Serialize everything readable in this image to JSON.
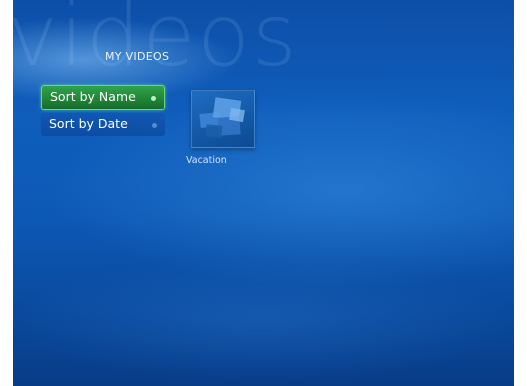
{
  "background_watermark": "videos",
  "section_title": "MY VIDEOS",
  "menu": {
    "items": [
      {
        "label": "Sort by Name",
        "selected": true
      },
      {
        "label": "Sort by Date",
        "selected": false
      }
    ]
  },
  "library": {
    "items": [
      {
        "caption": "Vacation",
        "icon": "video-folder-icon"
      }
    ]
  },
  "colors": {
    "background": "#0f5ebc",
    "selected_item": "#218737",
    "text": "#ffffff"
  }
}
